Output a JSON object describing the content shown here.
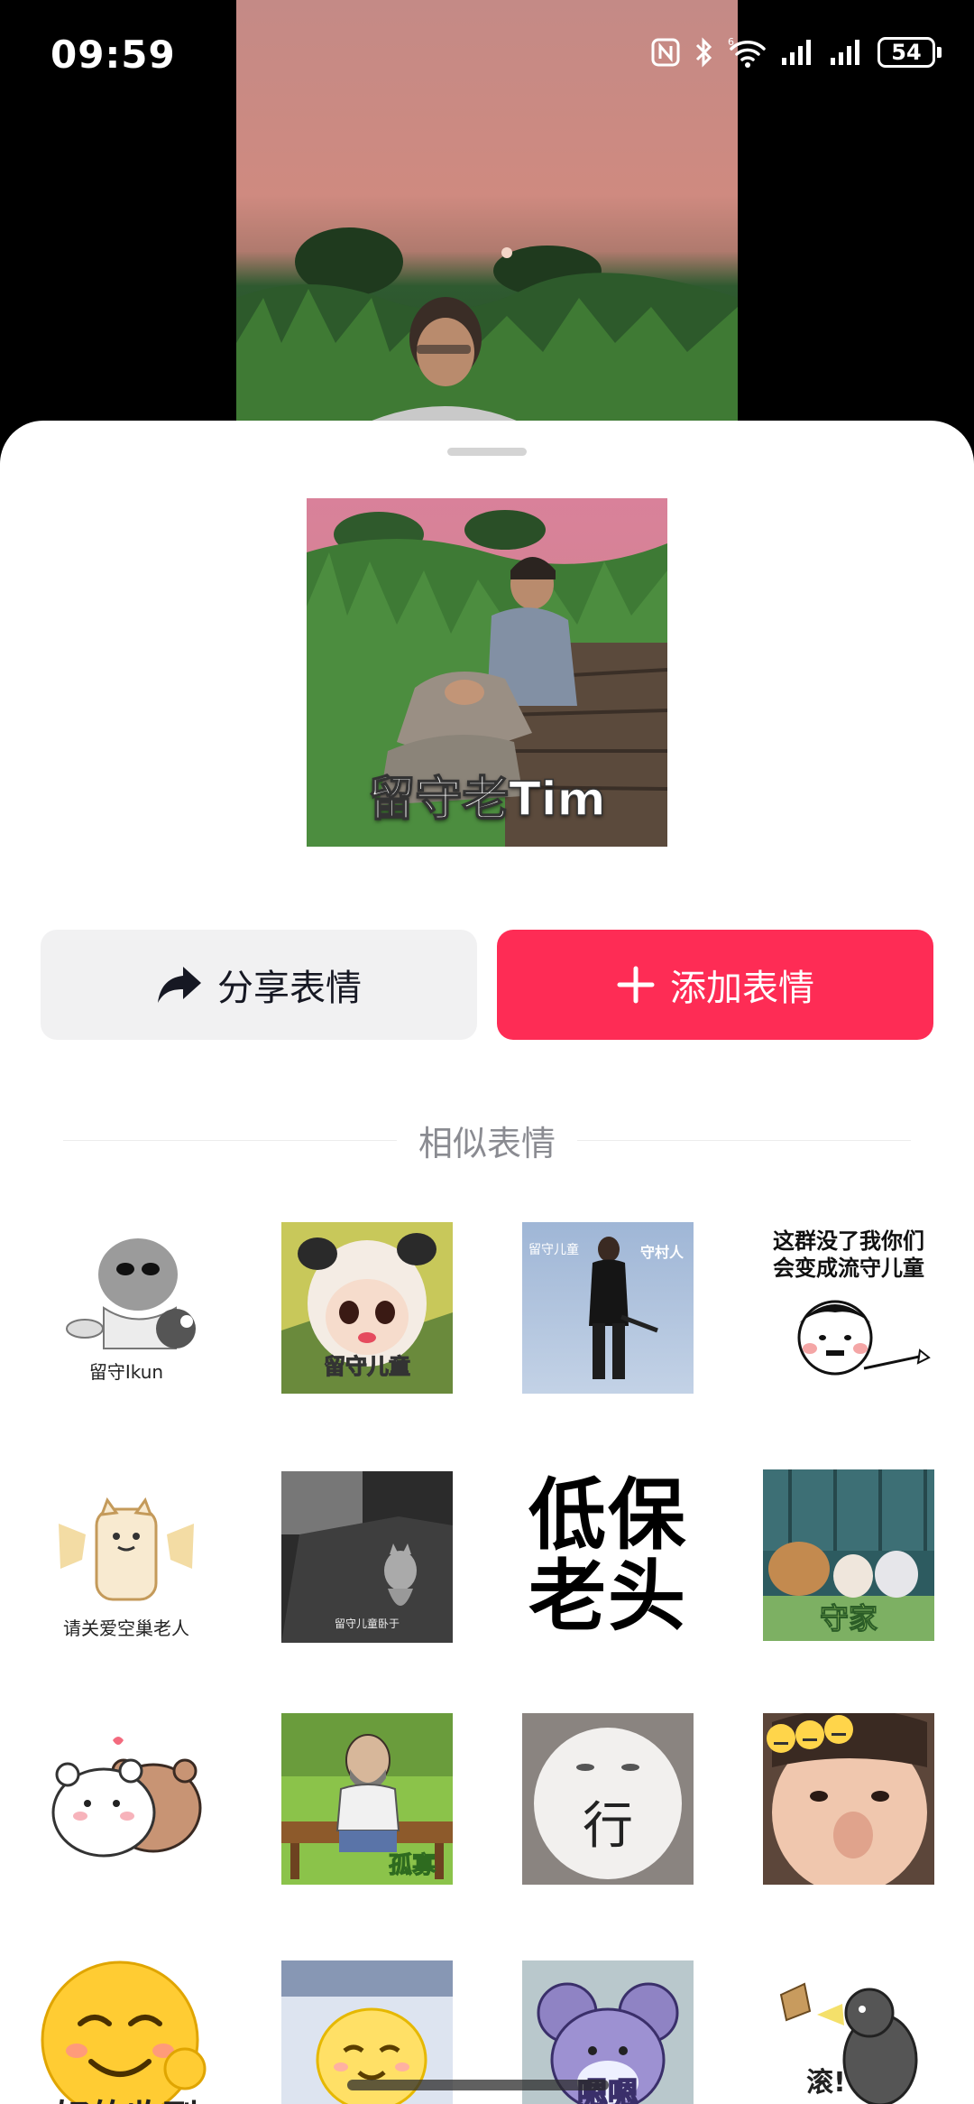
{
  "status_bar": {
    "time": "09:59",
    "battery": "54"
  },
  "sheet": {
    "preview_caption": "留守老Tim",
    "share_button": "分享表情",
    "add_button": "添加表情",
    "section_title": "相似表情"
  },
  "stickers": [
    {
      "caption": "留守Ikun"
    },
    {
      "caption": "留守儿童"
    },
    {
      "caption": "留守儿童",
      "tag": "守村人"
    },
    {
      "caption": "这群没了我你们\n会变成流守儿童"
    },
    {
      "caption": "请关爱空巢老人"
    },
    {
      "caption": "留守儿童卧于"
    },
    {
      "caption": "低保\n老头"
    },
    {
      "caption": "守家"
    },
    {
      "caption": ""
    },
    {
      "caption": "孤寡"
    },
    {
      "caption": "行"
    },
    {
      "caption": ""
    },
    {
      "caption": "好的收到"
    },
    {
      "caption": ""
    },
    {
      "caption": "嗯嗯"
    },
    {
      "caption": "滚!"
    }
  ],
  "colors": {
    "accent": "#fe2c55",
    "share_bg": "#f1f1f2"
  }
}
